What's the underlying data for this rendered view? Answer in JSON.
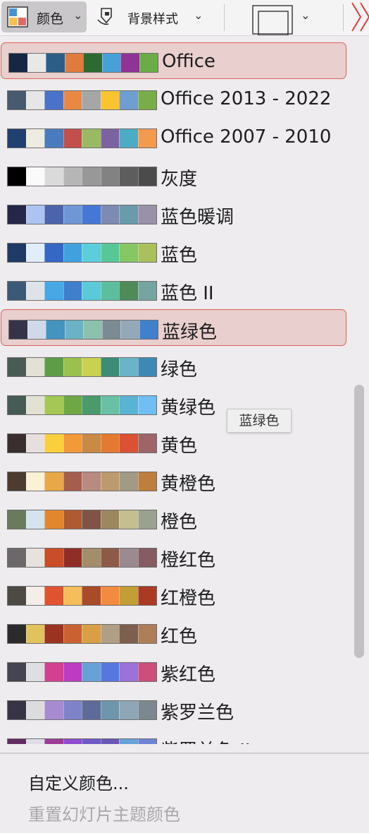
{
  "toolbar": {
    "colors_label": "颜色",
    "background_label": "背景样式",
    "colors_icon": "color-grid-icon",
    "background_icon": "background-style-icon",
    "slide_size_icon": "slide-size-icon"
  },
  "list": {
    "selected_index": 0,
    "hover_index": 7,
    "items": [
      {
        "name": "Office",
        "colors": [
          "#152742",
          "#e8e8e8",
          "#2b5d86",
          "#e07a3e",
          "#2d6a2f",
          "#46a1da",
          "#8f3494",
          "#6aac45"
        ]
      },
      {
        "name": "Office 2013 - 2022",
        "colors": [
          "#475a70",
          "#e7e6e6",
          "#4a72c8",
          "#e98844",
          "#a6a6a6",
          "#f9c42f",
          "#6e9ed2",
          "#78ad49"
        ]
      },
      {
        "name": "Office 2007 - 2010",
        "colors": [
          "#20406f",
          "#eeece1",
          "#4b7bbf",
          "#c14f4b",
          "#9bb963",
          "#7d62a1",
          "#4cacc6",
          "#f39a4f"
        ]
      },
      {
        "name": "灰度",
        "colors": [
          "#000000",
          "#fafafa",
          "#dadada",
          "#b6b6b6",
          "#989898",
          "#828282",
          "#5d5d5d",
          "#4b4b4b"
        ]
      },
      {
        "name": "蓝色暖调",
        "colors": [
          "#262648",
          "#adc4f2",
          "#4c64ab",
          "#6f97d6",
          "#4677d4",
          "#7d8bb3",
          "#6b9bab",
          "#9991a8"
        ]
      },
      {
        "name": "蓝色",
        "colors": [
          "#1f3a66",
          "#dfeefa",
          "#3468c4",
          "#41a0de",
          "#5bcddb",
          "#58c796",
          "#86c663",
          "#aac05c"
        ]
      },
      {
        "name": "蓝色 II",
        "colors": [
          "#3b5976",
          "#dfe3e8",
          "#48a8e6",
          "#3f7fcc",
          "#5bc9d7",
          "#5cbe9e",
          "#4f8b58",
          "#75a4a1"
        ]
      },
      {
        "name": "蓝绿色",
        "colors": [
          "#35334a",
          "#d1d9e7",
          "#4494bf",
          "#6bb3c4",
          "#8cc1ad",
          "#7c8b93",
          "#94a9b8",
          "#4280cb"
        ]
      },
      {
        "name": "绿色",
        "colors": [
          "#4a5b54",
          "#e3e0d4",
          "#5e9d46",
          "#9ac04d",
          "#c9d150",
          "#3c8c76",
          "#6bb4c8",
          "#3f87b5"
        ]
      },
      {
        "name": "黄绿色",
        "colors": [
          "#465b54",
          "#e2e2d4",
          "#a4c755",
          "#6ea744",
          "#4a9a6b",
          "#6ac0a5",
          "#59b3d2",
          "#70bef3"
        ]
      },
      {
        "name": "黄色",
        "colors": [
          "#3a2e2e",
          "#e7dfdf",
          "#f9cf3e",
          "#f29938",
          "#c98a46",
          "#e47a32",
          "#da5233",
          "#9e6467"
        ]
      },
      {
        "name": "黄橙色",
        "colors": [
          "#4d3b30",
          "#fbf1d5",
          "#e8a84a",
          "#a65e4c",
          "#b88a80",
          "#bd9a6d",
          "#a39a86",
          "#bd7e3e"
        ]
      },
      {
        "name": "橙色",
        "colors": [
          "#6a7a5d",
          "#d5e2ef",
          "#e3872f",
          "#b05a31",
          "#7f5444",
          "#9c8762",
          "#c5be8e",
          "#9aa28f"
        ]
      },
      {
        "name": "橙红色",
        "colors": [
          "#6c6869",
          "#e8e2de",
          "#c94d28",
          "#8f2e27",
          "#a48d6b",
          "#8e5a48",
          "#9b8a8f",
          "#855c61"
        ]
      },
      {
        "name": "红橙色",
        "colors": [
          "#4d4a43",
          "#f3eee7",
          "#e05331",
          "#f6bd5b",
          "#a84b29",
          "#f28b40",
          "#c39d35",
          "#aa3b22"
        ]
      },
      {
        "name": "红色",
        "colors": [
          "#2b2b2b",
          "#e2c25c",
          "#9c3321",
          "#c96133",
          "#d89f45",
          "#b09f84",
          "#7d5f50",
          "#ae7e59"
        ]
      },
      {
        "name": "紫红色",
        "colors": [
          "#454551",
          "#dedfe3",
          "#d44090",
          "#bc3bc2",
          "#68a1d8",
          "#5777e0",
          "#9c71d9",
          "#cb4f7a"
        ]
      },
      {
        "name": "紫罗兰色",
        "colors": [
          "#373545",
          "#dcdcdf",
          "#a78bd0",
          "#8082c9",
          "#5e6b99",
          "#6e95ab",
          "#8ea6b5",
          "#7b8890"
        ]
      },
      {
        "name": "紫罗兰色 II",
        "colors": [
          "#632c63",
          "#e0ddea",
          "#9e3b97",
          "#8f4bd4",
          "#6e58c8",
          "#6a56b8",
          "#66a3d8",
          "#6d83d6"
        ]
      }
    ]
  },
  "tooltip": {
    "text": "蓝绿色"
  },
  "bottom": {
    "custom_colors": "自定义颜色...",
    "reset_colors": "重置幻灯片主题颜色"
  }
}
